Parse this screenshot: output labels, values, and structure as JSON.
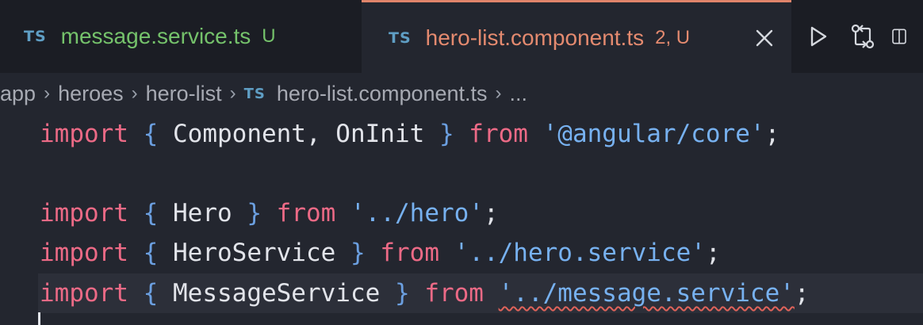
{
  "tabs": [
    {
      "lang_badge": "TS",
      "filename": "message.service.ts",
      "status": "U",
      "active": false
    },
    {
      "lang_badge": "TS",
      "filename": "hero-list.component.ts",
      "status": "2, U",
      "active": true
    }
  ],
  "actions": {
    "run_icon": "play-icon",
    "compare_icon": "git-compare-icon",
    "split_icon": "split-editor-icon"
  },
  "breadcrumb": {
    "items": [
      "app",
      "heroes",
      "hero-list"
    ],
    "file_badge": "TS",
    "file": "hero-list.component.ts",
    "more": "..."
  },
  "code": {
    "line1": {
      "kw_import": "import",
      "open_brace": "{",
      "names": "Component, OnInit",
      "close_brace": "}",
      "kw_from": "from",
      "module": "'@angular/core'",
      "end": ";"
    },
    "line3": {
      "kw_import": "import",
      "open_brace": "{",
      "names": "Hero",
      "close_brace": "}",
      "kw_from": "from",
      "module": "'../hero'",
      "end": ";"
    },
    "line4": {
      "kw_import": "import",
      "open_brace": "{",
      "names": "HeroService",
      "close_brace": "}",
      "kw_from": "from",
      "module": "'../hero.service'",
      "end": ";"
    },
    "line5": {
      "kw_import": "import",
      "open_brace": "{",
      "names": "MessageService",
      "close_brace": "}",
      "kw_from": "from",
      "module": "'../message.service'",
      "end": ";"
    }
  },
  "colors": {
    "keyword": "#ec6a86",
    "string": "#77b1f0",
    "untracked_tab": "#75c26b",
    "error_tab": "#e48a6f",
    "ts_badge": "#5f9ec4"
  }
}
